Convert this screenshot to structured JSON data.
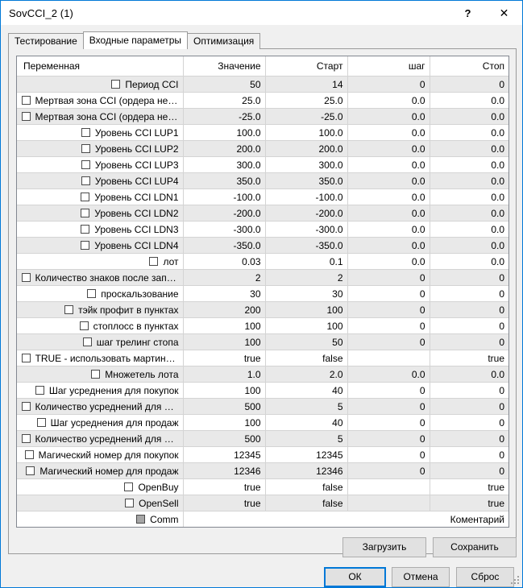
{
  "window": {
    "title": "SovCCI_2 (1)",
    "help_icon": "?",
    "close_icon": "✕",
    "accent_color": "#0078d7"
  },
  "tabs": [
    {
      "label": "Тестирование",
      "active": false
    },
    {
      "label": "Входные параметры",
      "active": true
    },
    {
      "label": "Оптимизация",
      "active": false
    }
  ],
  "grid": {
    "columns": [
      "Переменная",
      "Значение",
      "Старт",
      "шаг",
      "Стоп"
    ],
    "rows": [
      {
        "checked": false,
        "disabled": false,
        "name": "Период CCI",
        "value": "50",
        "start": "14",
        "step": "0",
        "stop": "0",
        "kind": "number"
      },
      {
        "checked": false,
        "disabled": false,
        "name": "Мертвая зона CCI (ордера не от...",
        "value": "25.0",
        "start": "25.0",
        "step": "0.0",
        "stop": "0.0",
        "kind": "number"
      },
      {
        "checked": false,
        "disabled": false,
        "name": "Мертвая зона CCI (ордера не от...",
        "value": "-25.0",
        "start": "-25.0",
        "step": "0.0",
        "stop": "0.0",
        "kind": "number"
      },
      {
        "checked": false,
        "disabled": false,
        "name": "Уровень CCI LUP1",
        "value": "100.0",
        "start": "100.0",
        "step": "0.0",
        "stop": "0.0",
        "kind": "number"
      },
      {
        "checked": false,
        "disabled": false,
        "name": "Уровень CCI LUP2",
        "value": "200.0",
        "start": "200.0",
        "step": "0.0",
        "stop": "0.0",
        "kind": "number"
      },
      {
        "checked": false,
        "disabled": false,
        "name": "Уровень CCI LUP3",
        "value": "300.0",
        "start": "300.0",
        "step": "0.0",
        "stop": "0.0",
        "kind": "number"
      },
      {
        "checked": false,
        "disabled": false,
        "name": "Уровень CCI LUP4",
        "value": "350.0",
        "start": "350.0",
        "step": "0.0",
        "stop": "0.0",
        "kind": "number"
      },
      {
        "checked": false,
        "disabled": false,
        "name": "Уровень CCI LDN1",
        "value": "-100.0",
        "start": "-100.0",
        "step": "0.0",
        "stop": "0.0",
        "kind": "number"
      },
      {
        "checked": false,
        "disabled": false,
        "name": "Уровень CCI LDN2",
        "value": "-200.0",
        "start": "-200.0",
        "step": "0.0",
        "stop": "0.0",
        "kind": "number"
      },
      {
        "checked": false,
        "disabled": false,
        "name": "Уровень CCI LDN3",
        "value": "-300.0",
        "start": "-300.0",
        "step": "0.0",
        "stop": "0.0",
        "kind": "number"
      },
      {
        "checked": false,
        "disabled": false,
        "name": "Уровень CCI LDN4",
        "value": "-350.0",
        "start": "-350.0",
        "step": "0.0",
        "stop": "0.0",
        "kind": "number"
      },
      {
        "checked": false,
        "disabled": false,
        "name": "лот",
        "value": "0.03",
        "start": "0.1",
        "step": "0.0",
        "stop": "0.0",
        "kind": "number"
      },
      {
        "checked": false,
        "disabled": false,
        "name": "Количество знаков после запят...",
        "value": "2",
        "start": "2",
        "step": "0",
        "stop": "0",
        "kind": "number"
      },
      {
        "checked": false,
        "disabled": false,
        "name": "проскальзование",
        "value": "30",
        "start": "30",
        "step": "0",
        "stop": "0",
        "kind": "number"
      },
      {
        "checked": false,
        "disabled": false,
        "name": "тэйк профит в пунктах",
        "value": "200",
        "start": "100",
        "step": "0",
        "stop": "0",
        "kind": "number"
      },
      {
        "checked": false,
        "disabled": false,
        "name": "стоплосс в пунктах",
        "value": "100",
        "start": "100",
        "step": "0",
        "stop": "0",
        "kind": "number"
      },
      {
        "checked": false,
        "disabled": false,
        "name": "шаг трелинг стопа",
        "value": "100",
        "start": "50",
        "step": "0",
        "stop": "0",
        "kind": "number"
      },
      {
        "checked": false,
        "disabled": false,
        "name": "TRUE - использовать мартингейл",
        "value": "true",
        "start": "false",
        "step": "",
        "stop": "true",
        "kind": "bool"
      },
      {
        "checked": false,
        "disabled": false,
        "name": "Множетель лота",
        "value": "1.0",
        "start": "2.0",
        "step": "0.0",
        "stop": "0.0",
        "kind": "number"
      },
      {
        "checked": false,
        "disabled": false,
        "name": "Шаг усреднения для покупок",
        "value": "100",
        "start": "40",
        "step": "0",
        "stop": "0",
        "kind": "number"
      },
      {
        "checked": false,
        "disabled": false,
        "name": "Количество усреднений для пок...",
        "value": "500",
        "start": "5",
        "step": "0",
        "stop": "0",
        "kind": "number"
      },
      {
        "checked": false,
        "disabled": false,
        "name": "Шаг усреднения для продаж",
        "value": "100",
        "start": "40",
        "step": "0",
        "stop": "0",
        "kind": "number"
      },
      {
        "checked": false,
        "disabled": false,
        "name": "Количество усреднений для про...",
        "value": "500",
        "start": "5",
        "step": "0",
        "stop": "0",
        "kind": "number"
      },
      {
        "checked": false,
        "disabled": false,
        "name": "Магический номер для покупок",
        "value": "12345",
        "start": "12345",
        "step": "0",
        "stop": "0",
        "kind": "number"
      },
      {
        "checked": false,
        "disabled": false,
        "name": "Магический номер для продаж",
        "value": "12346",
        "start": "12346",
        "step": "0",
        "stop": "0",
        "kind": "number"
      },
      {
        "checked": false,
        "disabled": false,
        "name": "OpenBuy",
        "value": "true",
        "start": "false",
        "step": "",
        "stop": "true",
        "kind": "bool"
      },
      {
        "checked": false,
        "disabled": false,
        "name": "OpenSell",
        "value": "true",
        "start": "false",
        "step": "",
        "stop": "true",
        "kind": "bool"
      },
      {
        "checked": false,
        "disabled": true,
        "name": "Comm",
        "value": "Коментарий",
        "start": "",
        "step": "",
        "stop": "",
        "kind": "string"
      }
    ]
  },
  "panel_buttons": {
    "load": "Загрузить",
    "save": "Сохранить"
  },
  "dialog_buttons": {
    "ok": "ОК",
    "cancel": "Отмена",
    "reset": "Сброс"
  }
}
